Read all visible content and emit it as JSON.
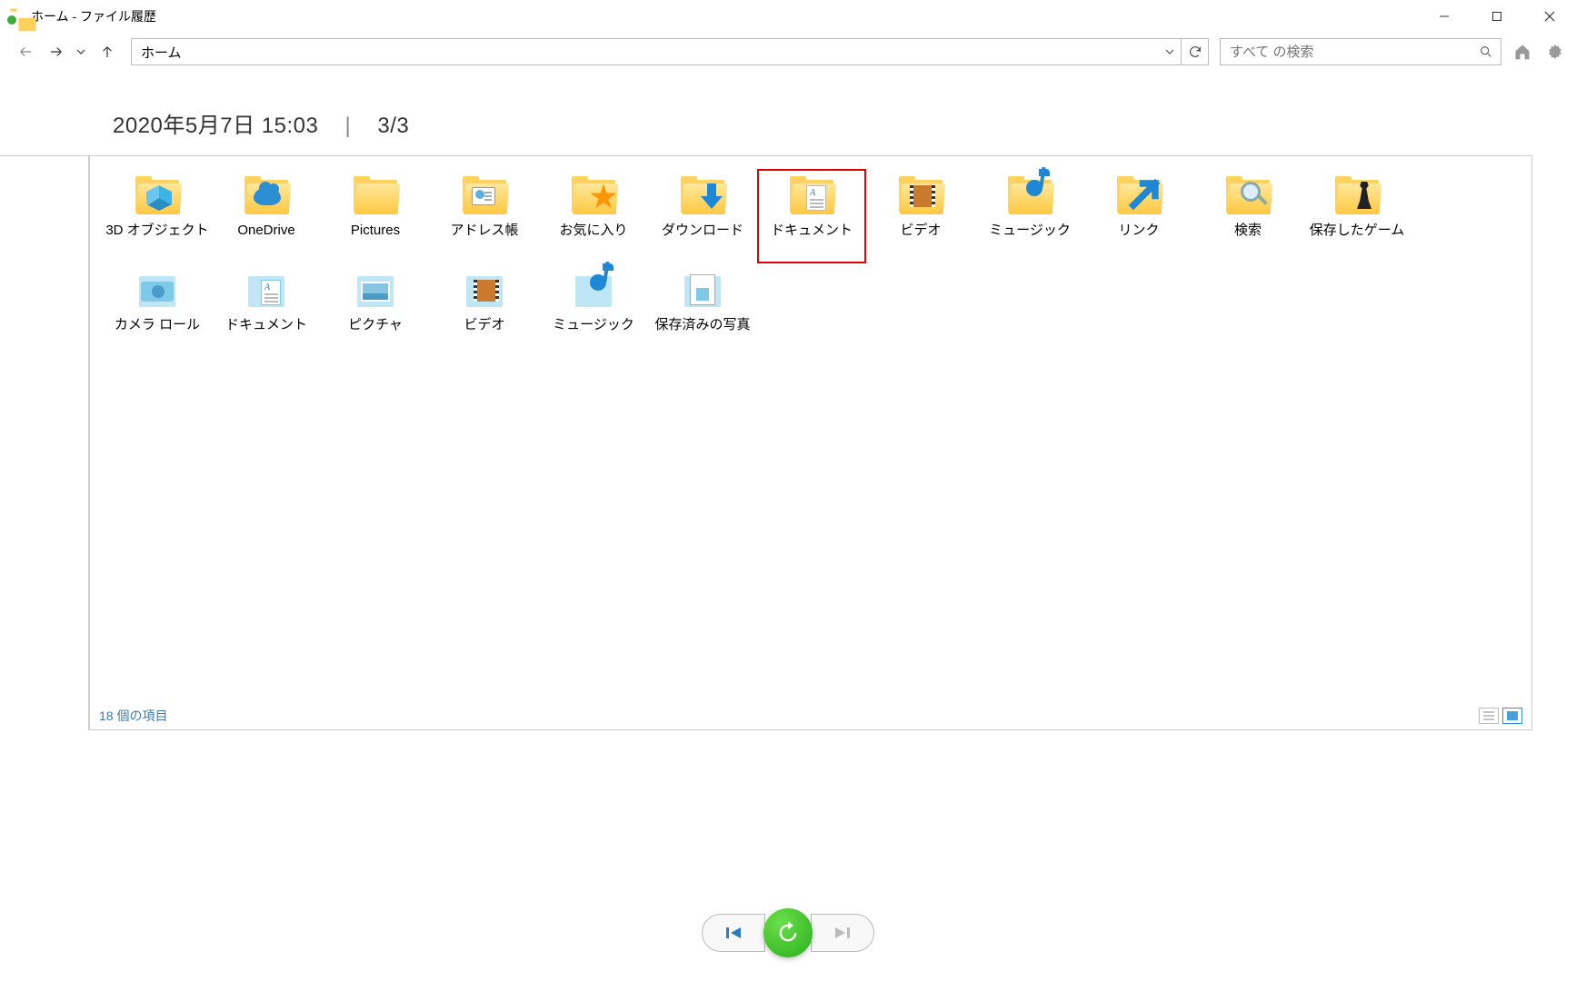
{
  "window": {
    "title": "ホーム - ファイル履歴"
  },
  "toolbar": {
    "address_value": "ホーム",
    "search_placeholder": "すべて の検索"
  },
  "header": {
    "datetime": "2020年5月7日 15:03",
    "page_indicator": "3/3"
  },
  "items": [
    {
      "label": "3D オブジェクト",
      "icon": "3d"
    },
    {
      "label": "OneDrive",
      "icon": "onedrive"
    },
    {
      "label": "Pictures",
      "icon": "folder"
    },
    {
      "label": "アドレス帳",
      "icon": "contacts"
    },
    {
      "label": "お気に入り",
      "icon": "favorites"
    },
    {
      "label": "ダウンロード",
      "icon": "downloads"
    },
    {
      "label": "ドキュメント",
      "icon": "documents",
      "selected": true
    },
    {
      "label": "ビデオ",
      "icon": "videos"
    },
    {
      "label": "ミュージック",
      "icon": "music"
    },
    {
      "label": "リンク",
      "icon": "links"
    },
    {
      "label": "検索",
      "icon": "search"
    },
    {
      "label": "保存したゲーム",
      "icon": "games"
    },
    {
      "label": "カメラ ロール",
      "icon": "lib-camera"
    },
    {
      "label": "ドキュメント",
      "icon": "lib-doc"
    },
    {
      "label": "ピクチャ",
      "icon": "lib-pic"
    },
    {
      "label": "ビデオ",
      "icon": "lib-video"
    },
    {
      "label": "ミュージック",
      "icon": "lib-music"
    },
    {
      "label": "保存済みの写真",
      "icon": "lib-saved"
    }
  ],
  "status": {
    "text": "18 個の項目"
  }
}
